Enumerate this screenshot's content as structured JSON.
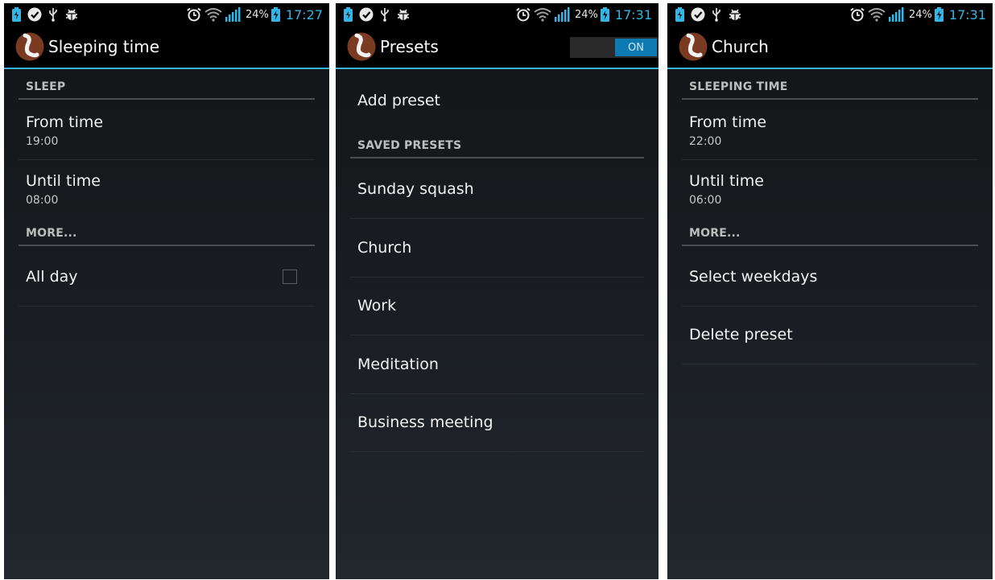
{
  "screens": [
    {
      "status": {
        "battery_pct": "24%",
        "time": "17:27"
      },
      "title": "Sleeping time",
      "section_sleep": "SLEEP",
      "from_time": {
        "label": "From time",
        "value": "19:00"
      },
      "until_time": {
        "label": "Until time",
        "value": "08:00"
      },
      "section_more": "MORE...",
      "all_day": {
        "label": "All day",
        "checked": false
      }
    },
    {
      "status": {
        "battery_pct": "24%",
        "time": "17:31"
      },
      "title": "Presets",
      "toggle_label": "ON",
      "add_preset": "Add preset",
      "section_saved": "SAVED PRESETS",
      "presets": [
        "Sunday squash",
        "Church",
        "Work",
        "Meditation",
        "Business meeting"
      ]
    },
    {
      "status": {
        "battery_pct": "24%",
        "time": "17:31"
      },
      "title": "Church",
      "section_sleeping_time": "SLEEPING TIME",
      "from_time": {
        "label": "From time",
        "value": "22:00"
      },
      "until_time": {
        "label": "Until time",
        "value": "06:00"
      },
      "section_more": "MORE...",
      "select_weekdays": "Select weekdays",
      "delete_preset": "Delete preset"
    }
  ],
  "colors": {
    "accent": "#33b5e5",
    "toggle_on": "#0f7ab2",
    "background": "#181b20",
    "logo_brown": "#7a3b22"
  },
  "icons": {
    "status_left": [
      "battery-saver-icon",
      "checkmark-badge-icon",
      "usb-icon",
      "android-debug-icon"
    ],
    "status_right": [
      "alarm-icon",
      "wifi-icon",
      "signal-bars-icon",
      "battery-charging-icon"
    ],
    "app": "app-logo-icon"
  }
}
